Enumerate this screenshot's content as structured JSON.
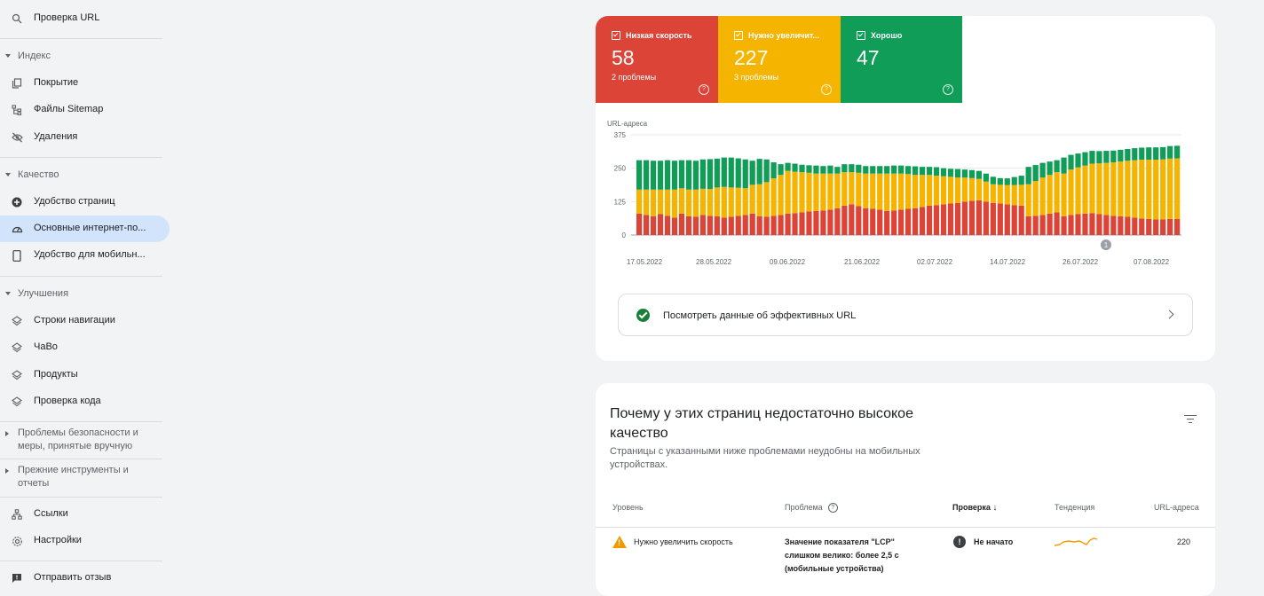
{
  "sidebar": {
    "url_inspection": "Проверка URL",
    "sections": {
      "index": "Индекс",
      "quality": "Качество",
      "enhancements": "Улучшения",
      "security": "Проблемы безопасности и меры, принятые вручную",
      "legacy": "Прежние инструменты и отчеты"
    },
    "items": {
      "coverage": "Покрытие",
      "sitemaps": "Файлы Sitemap",
      "removals": "Удаления",
      "page_experience": "Удобство страниц",
      "core_web_vitals": "Основные интернет-по...",
      "mobile_usability": "Удобство для мобильн...",
      "breadcrumbs": "Строки навигации",
      "faq": "ЧаВо",
      "products": "Продукты",
      "code_check": "Проверка кода",
      "links": "Ссылки",
      "settings": "Настройки",
      "feedback": "Отправить отзыв"
    }
  },
  "tiles": [
    {
      "label": "Низкая скорость",
      "value": "58",
      "sub": "2 проблемы",
      "color": "#db4437"
    },
    {
      "label": "Нужно увеличит...",
      "value": "227",
      "sub": "3 проблемы",
      "color": "#f4b400"
    },
    {
      "label": "Хорошо",
      "value": "47",
      "sub": "",
      "color": "#0f9d58"
    }
  ],
  "chart_data": {
    "type": "bar",
    "stacked": true,
    "ylabel": "URL-адреса",
    "yticks": [
      0,
      125,
      250,
      375
    ],
    "ylim": [
      0,
      375
    ],
    "xticks": [
      "17.05.2022",
      "28.05.2022",
      "09.06.2022",
      "21.06.2022",
      "02.07.2022",
      "14.07.2022",
      "26.07.2022",
      "07.08.2022"
    ],
    "annotation": "1",
    "colors": {
      "poor": "#db4437",
      "needs_improvement": "#f4b400",
      "good": "#0f9d58"
    },
    "series": [
      {
        "name": "Низкая скорость",
        "values": [
          80,
          75,
          70,
          78,
          72,
          65,
          80,
          70,
          68,
          75,
          72,
          70,
          65,
          68,
          72,
          75,
          80,
          70,
          68,
          72,
          75,
          80,
          82,
          85,
          88,
          90,
          92,
          95,
          100,
          110,
          115,
          108,
          100,
          98,
          95,
          90,
          92,
          95,
          98,
          100,
          105,
          110,
          112,
          115,
          118,
          120,
          125,
          128,
          130,
          125,
          120,
          118,
          115,
          112,
          110,
          70,
          72,
          75,
          80,
          85,
          70,
          75,
          78,
          80,
          82,
          78,
          75,
          72,
          70,
          68,
          65,
          62,
          60,
          58,
          58,
          60,
          60
        ]
      },
      {
        "name": "Нужно увеличит...",
        "values": [
          90,
          95,
          100,
          92,
          98,
          105,
          95,
          100,
          102,
          98,
          100,
          108,
          115,
          110,
          105,
          100,
          108,
          120,
          130,
          140,
          150,
          160,
          155,
          150,
          145,
          140,
          138,
          135,
          130,
          125,
          120,
          125,
          130,
          132,
          135,
          140,
          138,
          135,
          130,
          125,
          120,
          115,
          110,
          105,
          100,
          95,
          90,
          85,
          80,
          75,
          70,
          70,
          72,
          75,
          78,
          120,
          130,
          140,
          145,
          150,
          160,
          170,
          175,
          180,
          185,
          190,
          195,
          200,
          205,
          210,
          215,
          220,
          222,
          224,
          225,
          226,
          227
        ]
      },
      {
        "name": "Хорошо",
        "values": [
          110,
          110,
          108,
          108,
          110,
          108,
          105,
          110,
          108,
          110,
          112,
          108,
          110,
          112,
          110,
          108,
          90,
          95,
          85,
          60,
          40,
          30,
          30,
          28,
          28,
          30,
          28,
          30,
          25,
          30,
          30,
          30,
          28,
          28,
          28,
          28,
          30,
          30,
          30,
          32,
          30,
          30,
          32,
          30,
          30,
          32,
          30,
          30,
          30,
          30,
          28,
          25,
          25,
          30,
          34,
          65,
          60,
          55,
          50,
          45,
          60,
          55,
          52,
          50,
          48,
          46,
          45,
          44,
          44,
          44,
          45,
          45,
          46,
          46,
          46,
          47,
          47
        ]
      }
    ]
  },
  "effective_urls_label": "Посмотреть данные об эффективных URL",
  "details": {
    "title": "Почему у этих страниц недостаточно высокое качество",
    "subtitle": "Страницы с указанными ниже проблемами неудобны на мобильных устройствах.",
    "columns": {
      "level": "Уровень",
      "problem": "Проблема",
      "check": "Проверка",
      "trend": "Тенденция",
      "urls": "URL-адреса"
    },
    "rows": [
      {
        "level": "Нужно увеличить скорость",
        "problem": "Значение показателя \"LCP\" слишком велико: более 2,5 с (мобильные устройства)",
        "check": "Не начато",
        "urls": "220"
      }
    ]
  }
}
